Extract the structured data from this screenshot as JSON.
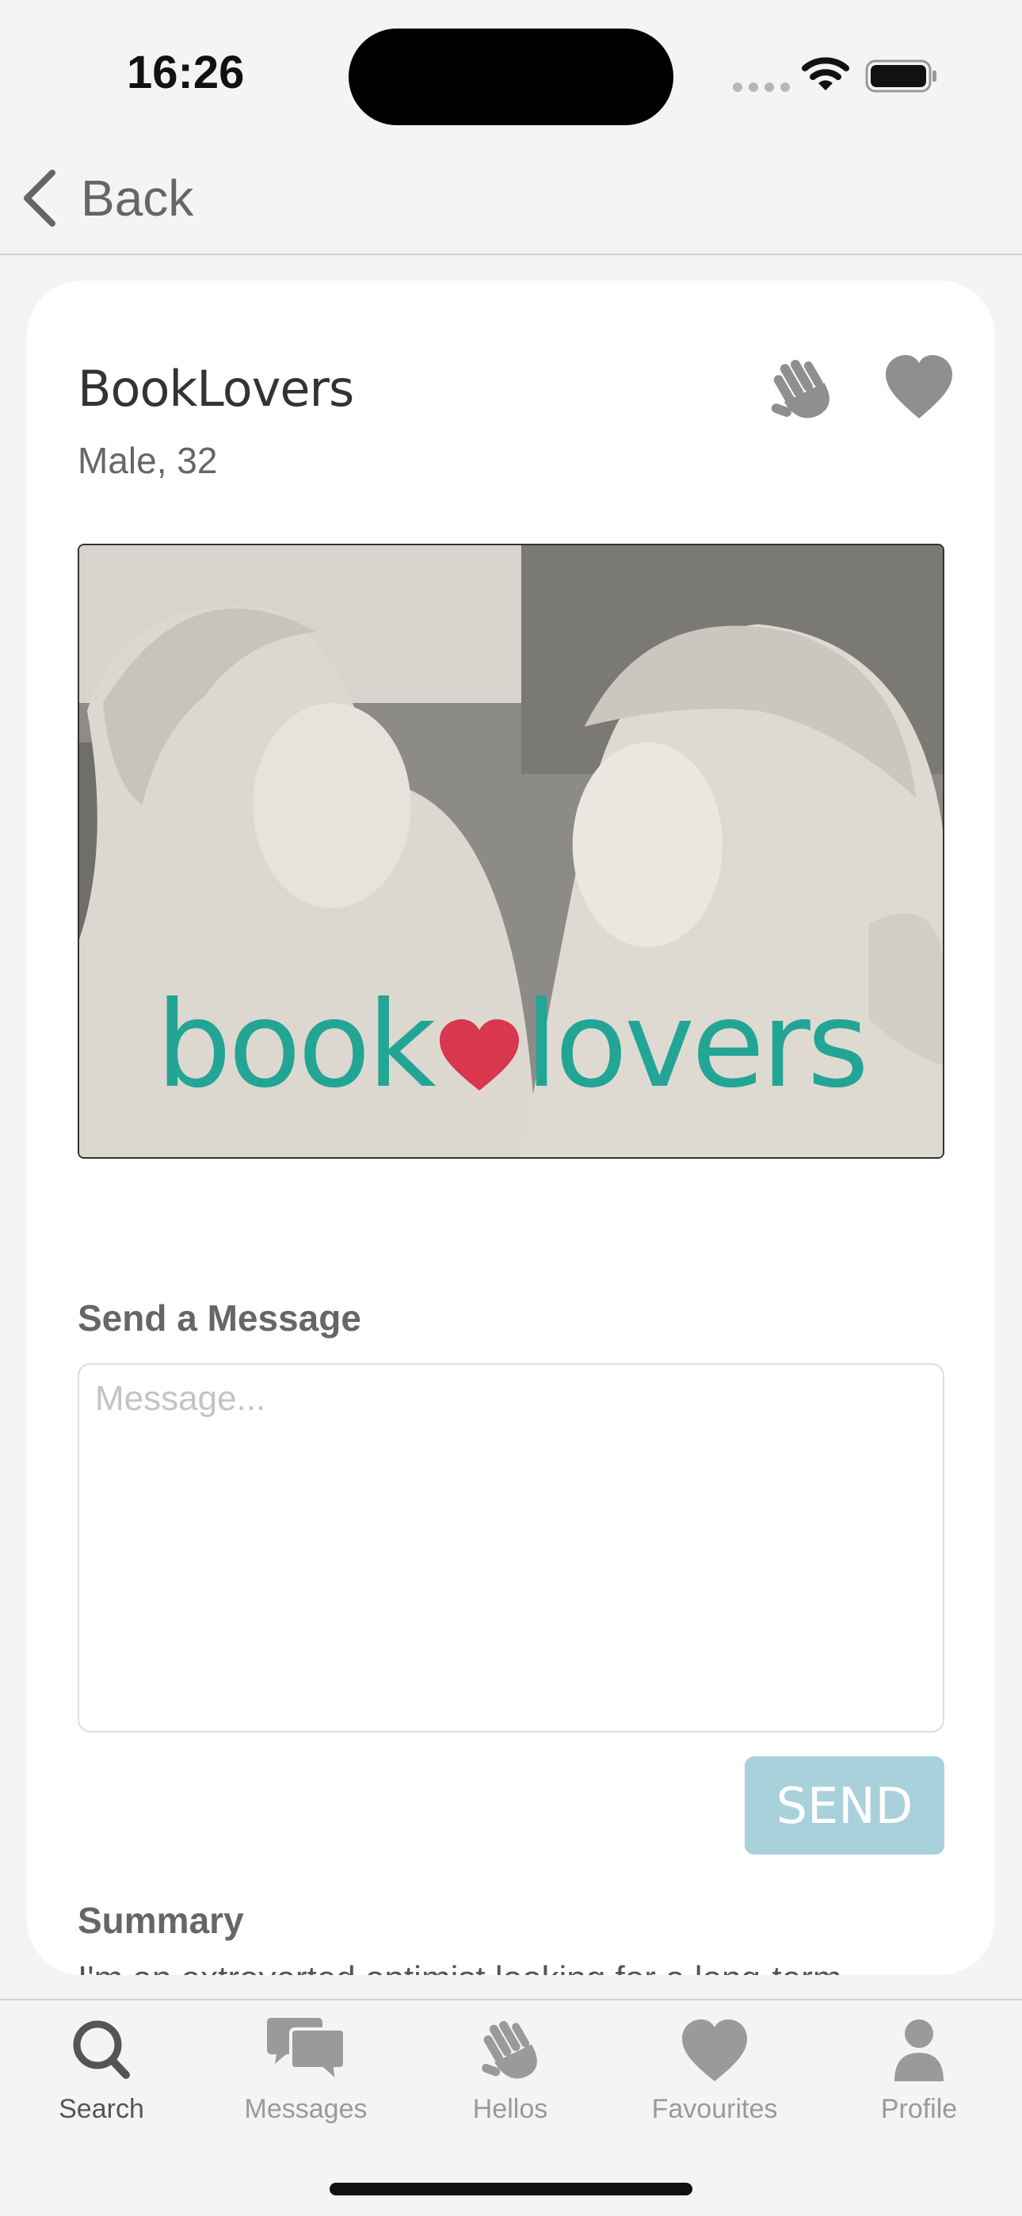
{
  "status_bar": {
    "time": "16:26"
  },
  "nav": {
    "back_label": "Back"
  },
  "profile": {
    "name": "BookLovers",
    "meta": "Male, 32",
    "photo_logo_left": "book",
    "photo_logo_right": "lovers"
  },
  "message": {
    "section_label": "Send a Message",
    "placeholder": "Message...",
    "value": "",
    "send_label": "SEND"
  },
  "summary": {
    "section_label": "Summary",
    "text": "I'm an extroverted optimist looking for a long-term"
  },
  "tabs": [
    {
      "label": "Search",
      "icon": "search-icon",
      "active": true
    },
    {
      "label": "Messages",
      "icon": "chat-bubbles-icon",
      "active": false
    },
    {
      "label": "Hellos",
      "icon": "wave-hand-icon",
      "active": false
    },
    {
      "label": "Favourites",
      "icon": "heart-icon",
      "active": false
    },
    {
      "label": "Profile",
      "icon": "person-icon",
      "active": false
    }
  ],
  "colors": {
    "send_button": "#a9d1dc",
    "logo_teal": "#23a596",
    "logo_heart": "#d8374e",
    "icon_gray": "#8f8f8f"
  }
}
